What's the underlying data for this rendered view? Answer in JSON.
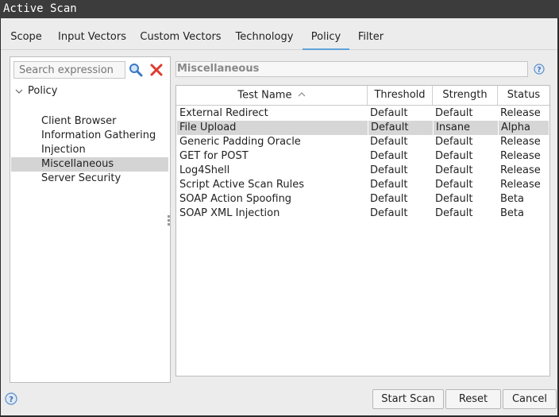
{
  "window": {
    "title": "Active Scan"
  },
  "tabs": [
    {
      "label": "Scope"
    },
    {
      "label": "Input Vectors"
    },
    {
      "label": "Custom Vectors"
    },
    {
      "label": "Technology"
    },
    {
      "label": "Policy",
      "active": true
    },
    {
      "label": "Filter"
    }
  ],
  "search": {
    "placeholder": "Search expression"
  },
  "tree": {
    "root": "Policy",
    "items": [
      {
        "label": "Client Browser"
      },
      {
        "label": "Information Gathering"
      },
      {
        "label": "Injection"
      },
      {
        "label": "Miscellaneous",
        "selected": true
      },
      {
        "label": "Server Security"
      }
    ]
  },
  "category": {
    "name": "Miscellaneous"
  },
  "table": {
    "columns": [
      "Test Name",
      "Threshold",
      "Strength",
      "Status"
    ],
    "sort_column": "Test Name",
    "rows": [
      {
        "name": "External Redirect",
        "threshold": "Default",
        "strength": "Default",
        "status": "Release"
      },
      {
        "name": "File Upload",
        "threshold": "Default",
        "strength": "Insane",
        "status": "Alpha",
        "selected": true
      },
      {
        "name": "Generic Padding Oracle",
        "threshold": "Default",
        "strength": "Default",
        "status": "Release"
      },
      {
        "name": "GET for POST",
        "threshold": "Default",
        "strength": "Default",
        "status": "Release"
      },
      {
        "name": "Log4Shell",
        "threshold": "Default",
        "strength": "Default",
        "status": "Release"
      },
      {
        "name": "Script Active Scan Rules",
        "threshold": "Default",
        "strength": "Default",
        "status": "Release"
      },
      {
        "name": "SOAP Action Spoofing",
        "threshold": "Default",
        "strength": "Default",
        "status": "Beta"
      },
      {
        "name": "SOAP XML Injection",
        "threshold": "Default",
        "strength": "Default",
        "status": "Beta"
      }
    ]
  },
  "buttons": {
    "start": "Start Scan",
    "reset": "Reset",
    "cancel": "Cancel"
  },
  "icons": {
    "search": "magnifier-icon",
    "clear": "red-x-icon",
    "help": "help-icon",
    "sort": "sort-ascending-icon"
  },
  "colors": {
    "accent": "#5fa0d8",
    "clear_red": "#e03a2f",
    "help_blue": "#5b8fc9"
  }
}
